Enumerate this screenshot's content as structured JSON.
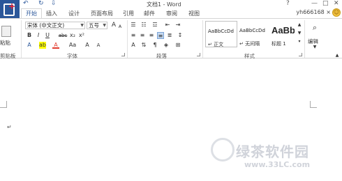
{
  "window": {
    "title": "文档1 - Word",
    "help": "?",
    "controls": [
      "—",
      "□",
      "✕"
    ]
  },
  "quick_access": {
    "undo": "↶",
    "redo": "↻",
    "customize": "⇩"
  },
  "tabs": [
    "开始",
    "插入",
    "设计",
    "页面布局",
    "引用",
    "邮件",
    "审阅",
    "视图"
  ],
  "user": {
    "name": "yh666168 ×",
    "avatar": "smiley-face-avatar"
  },
  "ribbon": {
    "clipboard": {
      "paste": "粘贴",
      "label": "剪贴板"
    },
    "font": {
      "name": "宋体 (中文正文)",
      "size": "五号",
      "grow": "A",
      "shrink": "A",
      "format_buttons": [
        "B",
        "I",
        "U",
        "abc",
        "x₂",
        "x²"
      ],
      "label": "字体"
    },
    "paragraph": {
      "label": "段落"
    },
    "styles": {
      "items": [
        {
          "sample": "AaBbCcDd",
          "name": "↵ 正文"
        },
        {
          "sample": "AaBbCcDd",
          "name": "↵ 无间隔"
        },
        {
          "sample": "AaBb",
          "name": "标题 1"
        }
      ],
      "label": "样式"
    },
    "editing": {
      "label": "编辑"
    }
  },
  "document": {
    "paragraph_mark": "↵"
  },
  "watermark": {
    "text": "绿茶软件园",
    "url": "www.33LC.com"
  },
  "colors": {
    "accent": "#2b579a",
    "font_color": "#e23b2e",
    "highlight": "#ffff00"
  }
}
